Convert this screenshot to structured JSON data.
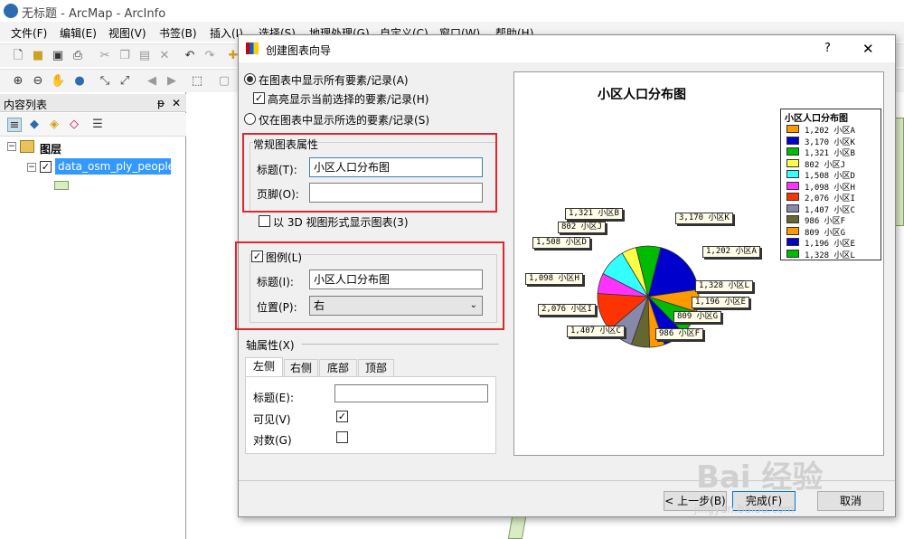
{
  "window": {
    "title": "无标题 - ArcMap - ArcInfo"
  },
  "menu": [
    "文件(F)",
    "编辑(E)",
    "视图(V)",
    "书签(B)",
    "插入(I)",
    "选择(S)",
    "地理处理(G)",
    "自定义(C)",
    "窗口(W)",
    "帮助(H)"
  ],
  "toc": {
    "title": "内容列表",
    "pin": "ᵽ",
    "close": "✕",
    "group": "图层",
    "layer": "data_osm_ply_people"
  },
  "dialog": {
    "title": "创建图表向导",
    "help": "?",
    "close": "✕",
    "radio_all": "在图表中显示所有要素/记录(A)",
    "highlight": "高亮显示当前选择的要素/记录(H)",
    "radio_selected": "仅在图表中显示所选的要素/记录(S)",
    "general": {
      "header": "常规图表属性",
      "title_label": "标题(T):",
      "title_value": "小区人口分布图",
      "footer_label": "页脚(O):",
      "footer_value": ""
    },
    "show3d": "以 3D 视图形式显示图表(3)",
    "legend": {
      "header": "图例(L)",
      "title_label": "标题(I):",
      "title_value": "小区人口分布图",
      "pos_label": "位置(P):",
      "pos_value": "右"
    },
    "axis": {
      "header": "轴属性(X)",
      "tabs": [
        "左侧",
        "右侧",
        "底部",
        "顶部"
      ],
      "title_label": "标题(E):",
      "title_value": "",
      "visible_label": "可见(V)",
      "log_label": "对数(G)"
    },
    "buttons": {
      "back": "< 上一步(B)",
      "finish": "完成(F)",
      "cancel": "取消"
    }
  },
  "chart_data": {
    "type": "pie",
    "title": "小区人口分布图",
    "legend_title": "小区人口分布图",
    "legend_position": "right",
    "items": [
      {
        "value": 1202,
        "label": "1,202  小区A",
        "color": "#ff9900"
      },
      {
        "value": 3170,
        "label": "3,170  小区K",
        "color": "#0000cc"
      },
      {
        "value": 1321,
        "label": "1,321  小区B",
        "color": "#00bb00"
      },
      {
        "value": 802,
        "label": "802  小区J",
        "color": "#ffff44"
      },
      {
        "value": 1508,
        "label": "1,508  小区D",
        "color": "#33ffff"
      },
      {
        "value": 1098,
        "label": "1,098  小区H",
        "color": "#ff33ff"
      },
      {
        "value": 2076,
        "label": "2,076  小区I",
        "color": "#ff3300"
      },
      {
        "value": 1407,
        "label": "1,407  小区C",
        "color": "#8888aa"
      },
      {
        "value": 986,
        "label": "986  小区F",
        "color": "#666633"
      },
      {
        "value": 809,
        "label": "809  小区G",
        "color": "#ff9900"
      },
      {
        "value": 1196,
        "label": "1,196  小区E",
        "color": "#0000cc"
      },
      {
        "value": 1328,
        "label": "1,328  小区L",
        "color": "#00bb00"
      }
    ],
    "pie_labels": [
      "1,321 小区B",
      "3,170 小区K",
      "802 小区J",
      "1,508 小区D",
      "1,202 小区A",
      "1,098 小区H",
      "1,328 小区L",
      "1,196 小区E",
      "2,076 小区I",
      "809 小区G",
      "1,407 小区C",
      "986 小区F"
    ]
  },
  "watermark": {
    "text": "Bai 经验",
    "url": "jingyan.baidu.com"
  }
}
